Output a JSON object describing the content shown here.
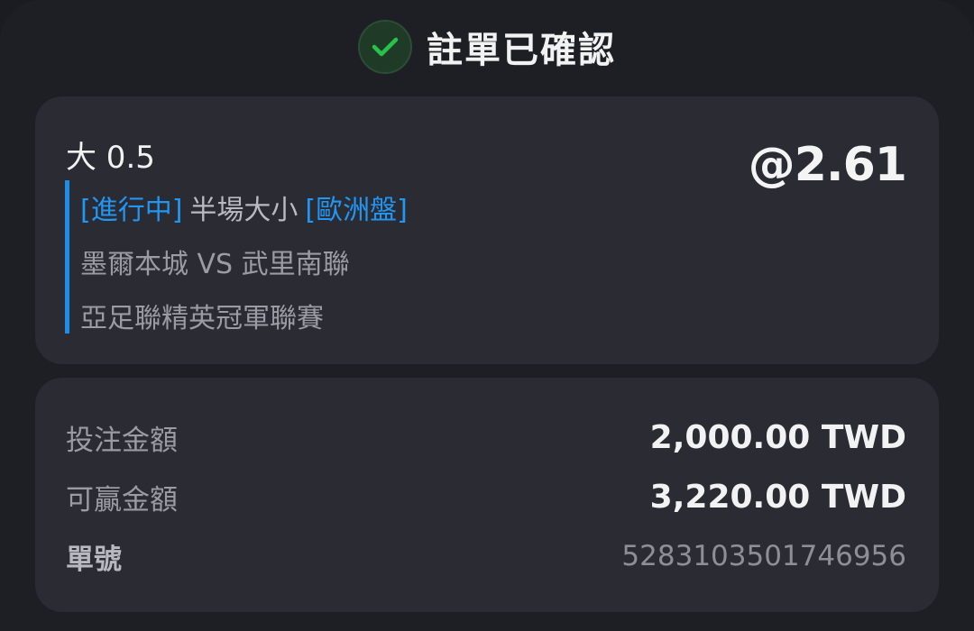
{
  "header": {
    "title": "註單已確認",
    "check_color": "#27c24a"
  },
  "bet": {
    "selection": "大 0.5",
    "odds": "@2.61",
    "status_tag": "[進行中]",
    "market": "半場大小",
    "odds_type": "[歐洲盤]",
    "match": "墨爾本城 VS 武里南聯",
    "league": "亞足聯精英冠軍聯賽"
  },
  "summary": {
    "stake_label": "投注金額",
    "stake_value": "2,000.00 TWD",
    "payout_label": "可贏金額",
    "payout_value": "3,220.00 TWD",
    "ticket_label": "單號",
    "ticket_value": "5283103501746956"
  },
  "colors": {
    "accent_blue": "#2196f3",
    "background": "#1e1f24",
    "card": "#2a2b33"
  }
}
